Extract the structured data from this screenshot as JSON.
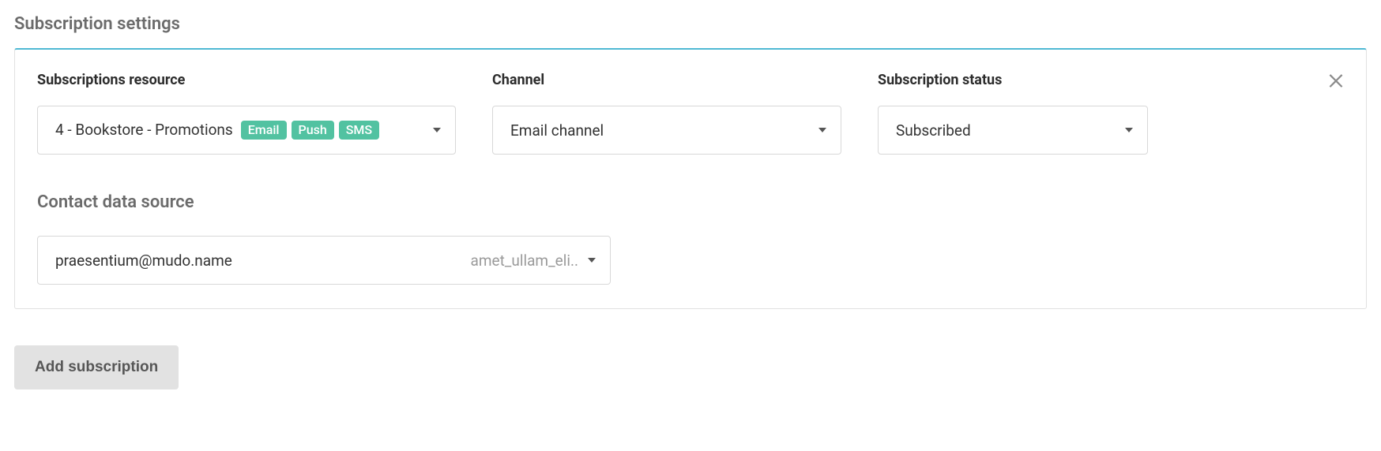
{
  "pageTitle": "Subscription settings",
  "labels": {
    "resource": "Subscriptions resource",
    "channel": "Channel",
    "status": "Subscription status",
    "contactSource": "Contact data source"
  },
  "selects": {
    "resource": {
      "text": "4 - Bookstore - Promotions",
      "tags": [
        "Email",
        "Push",
        "SMS"
      ]
    },
    "channel": "Email channel",
    "status": "Subscribed"
  },
  "contactSource": {
    "value": "praesentium@mudo.name",
    "hint": "amet_ullam_eli.."
  },
  "buttons": {
    "add": "Add subscription"
  }
}
